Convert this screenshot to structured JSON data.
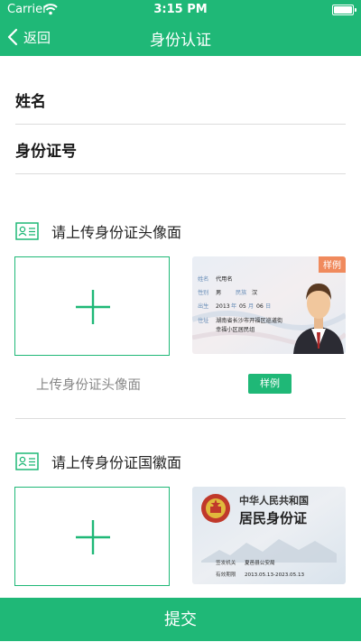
{
  "status_bar": {
    "carrier": "Carrier",
    "time": "3:15 PM"
  },
  "nav": {
    "back_label": "返回",
    "title": "身份认证"
  },
  "form": {
    "name_label": "姓名",
    "id_label": "身份证号"
  },
  "front_section": {
    "title": "请上传身份证头像面",
    "hint": "上传身份证头像面",
    "sample_button": "样例",
    "sample_card": {
      "corner_tag": "样例",
      "name_label": "姓名",
      "name_value": "代用名",
      "sex_label": "性别",
      "sex_value": "男",
      "ethnic_label": "民族",
      "ethnic_value": "汉",
      "birth_label": "出生",
      "birth_year": "2013",
      "birth_month_label": "年",
      "birth_month": "05",
      "birth_day_label": "月",
      "birth_day": "06",
      "birth_day_suffix": "日",
      "address_label": "住址",
      "address_line1": "湖南省长沙市开福区巡道街",
      "address_line2": "幸福小区居民组"
    }
  },
  "back_section": {
    "title": "请上传身份证国徽面",
    "sample_card": {
      "country": "中华人民共和国",
      "doc_name": "居民身份证",
      "authority_label": "签发机关",
      "authority_value": "夏邑县公安局",
      "validity_label": "有效期限",
      "validity_value": "2013.05.13-2023.05.13"
    }
  },
  "submit_label": "提交",
  "colors": {
    "accent": "#1fb877",
    "sample_tag": "#f08a5d"
  }
}
